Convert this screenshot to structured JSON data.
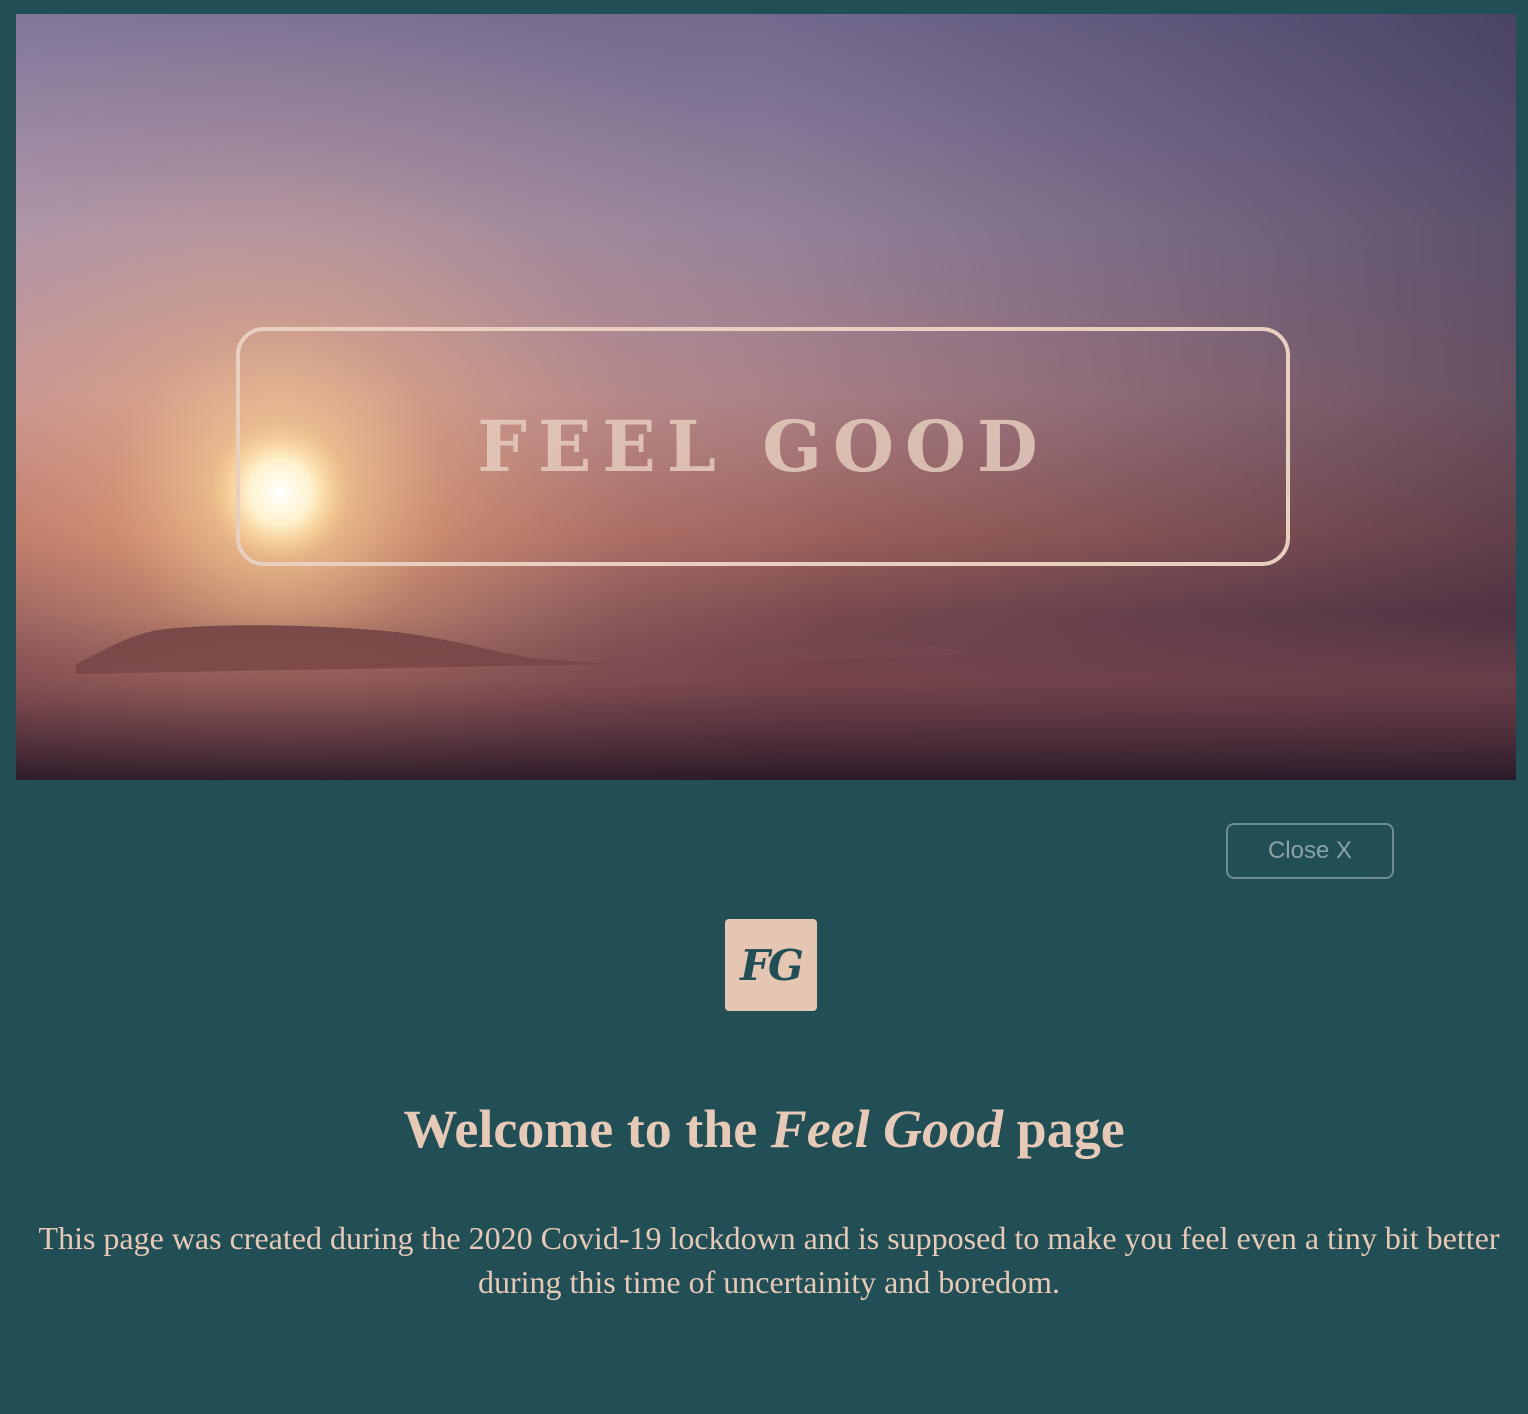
{
  "hero": {
    "title": "FEEL GOOD"
  },
  "controls": {
    "close_label": "Close X"
  },
  "logo": {
    "text": "FG"
  },
  "welcome": {
    "prefix": "Welcome to the ",
    "emphasis": "Feel Good",
    "suffix": " page"
  },
  "intro": {
    "text": "This page was created during the 2020 Covid-19 lockdown and is supposed to make you feel even a tiny bit better during this time of uncertainity and boredom."
  },
  "colors": {
    "background": "#224e56",
    "accent": "#e6c9b6"
  },
  "icons": {
    "sun": "sun-icon",
    "close": "close-icon"
  }
}
